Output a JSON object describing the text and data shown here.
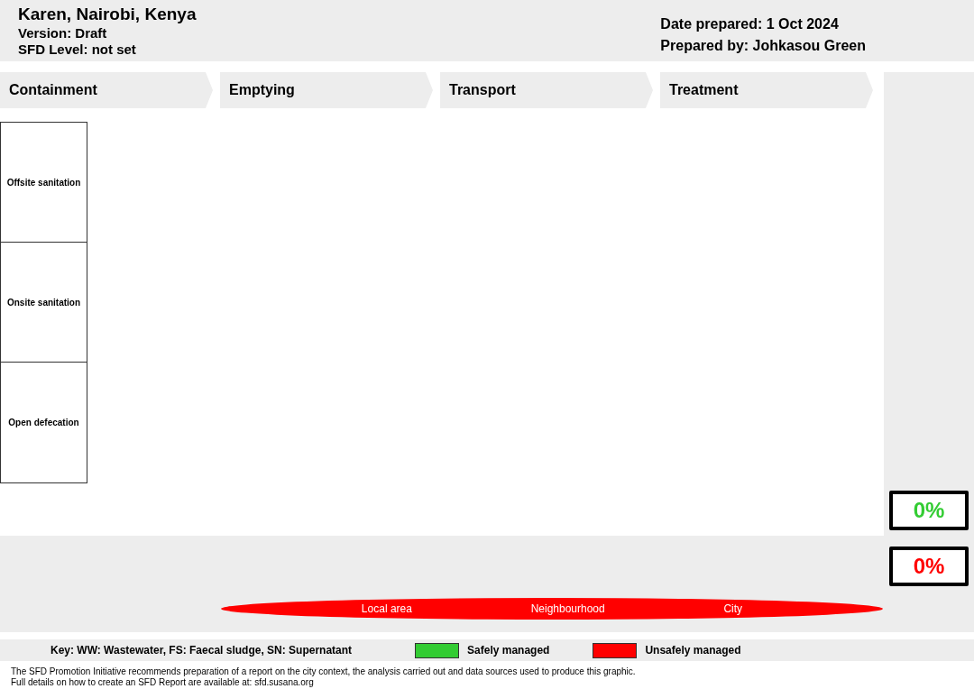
{
  "header": {
    "title": "Karen, Nairobi, Kenya",
    "version": "Version: Draft",
    "sfd_level": "SFD Level: not set",
    "date_prepared": "Date prepared: 1 Oct 2024",
    "prepared_by": "Prepared by: Johkasou Green"
  },
  "stages": [
    "Containment",
    "Emptying",
    "Transport",
    "Treatment"
  ],
  "sanitation_types": [
    "Offsite sanitation",
    "Onsite sanitation",
    "Open defecation"
  ],
  "totals": [
    {
      "kind": "safe",
      "value": "0%",
      "color": "#33cc33"
    },
    {
      "kind": "unsafe",
      "value": "0%",
      "color": "#ff0000"
    }
  ],
  "spread_band": {
    "color": "#ff0000",
    "labels": [
      "Local area",
      "Neighbourhood",
      "City"
    ]
  },
  "key": {
    "text": "Key: WW: Wastewater, FS: Faecal sludge, SN: Supernatant",
    "items": [
      {
        "label": "Safely managed",
        "color": "#33cc33"
      },
      {
        "label": "Unsafely managed",
        "color": "#ff0000"
      }
    ]
  },
  "footer": [
    "The SFD Promotion Initiative recommends preparation of a report on the city context, the analysis carried out and data sources used to produce this graphic.",
    "Full details on how to create an SFD Report are available at: sfd.susana.org"
  ]
}
